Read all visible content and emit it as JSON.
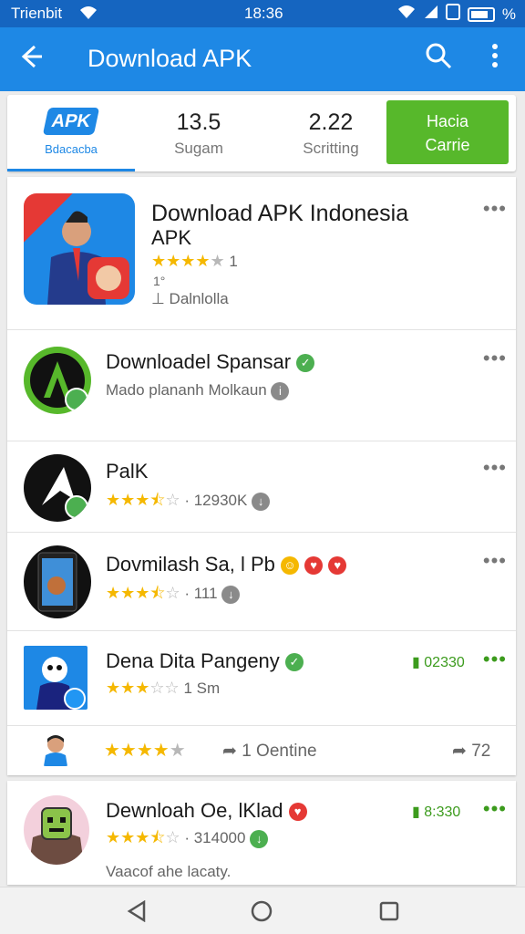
{
  "status_bar": {
    "carrier": "Trienbit",
    "time": "18:36",
    "battery_label": "%"
  },
  "app_bar": {
    "title": "Download APK"
  },
  "tabs": {
    "apk": {
      "logo": "APK",
      "label": "Bdacacba"
    },
    "t2": {
      "num": "13.5",
      "label": "Sugam"
    },
    "t3": {
      "num": "2.22",
      "label": "Scritting"
    },
    "action": {
      "line1": "Hacia",
      "line2": "Carrie"
    }
  },
  "apps": [
    {
      "name": "Download APK Indonesia",
      "name2": "APK",
      "rating": "1",
      "meta1": "1°",
      "meta2": "Dalnlolla",
      "stars": 4
    },
    {
      "name": "Downloadel Spansar",
      "sub": "Mado plananh Molkaun",
      "stars": 0
    },
    {
      "name": "PalK",
      "rating": "· 12930K",
      "stars": 3.5
    },
    {
      "name": "Dovmilash Sa, l Pb",
      "rating": "· 111",
      "stars": 3.5
    },
    {
      "name": "Dena Dita Pangeny",
      "rating": "1 Sm",
      "right": "02330",
      "stars": 3
    }
  ],
  "share_row": {
    "text": "1 Oentine",
    "count": "72",
    "stars": 4
  },
  "last_app": {
    "name": "Dewnloah Oe, lKlad",
    "rating": "· 314000",
    "right": "8:330",
    "sub": "Vaacof ahe lacaty.",
    "stars": 3.5
  },
  "icons": {
    "back": "arrow-left",
    "search": "magnifier",
    "more": "vertical-dots",
    "nav": [
      "back-triangle",
      "home-circle",
      "recents-square"
    ]
  },
  "colors": {
    "primary": "#1e88e5",
    "status": "#1565c0",
    "green": "#57b82b",
    "star": "#f5b800"
  }
}
